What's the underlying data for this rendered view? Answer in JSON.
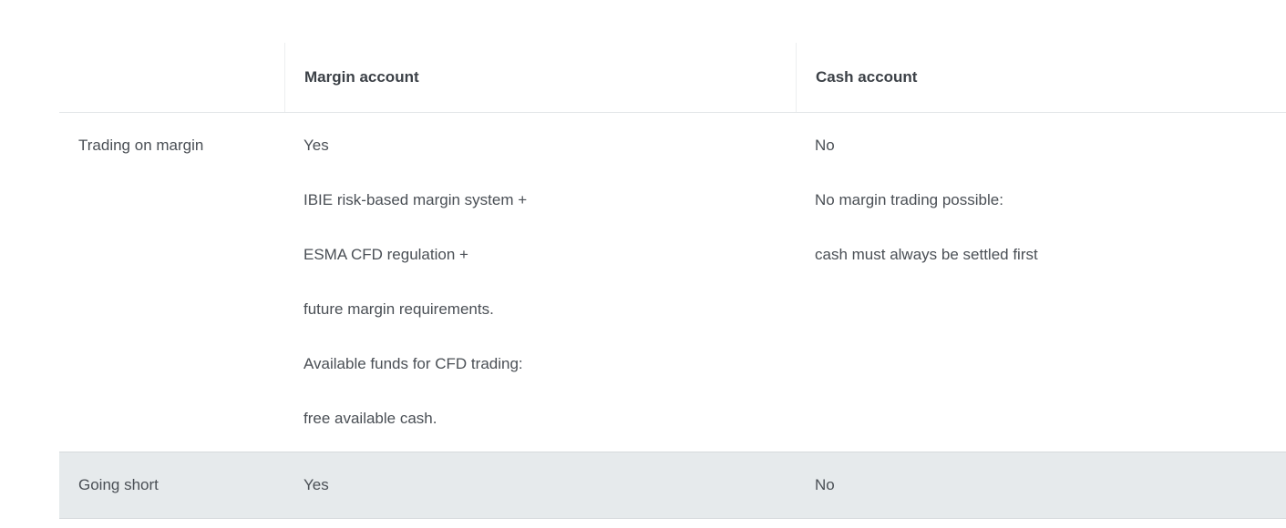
{
  "table": {
    "headers": [
      "",
      "Margin account",
      "Cash account"
    ],
    "rows": [
      {
        "label": "Trading on margin",
        "margin": [
          "Yes",
          "IBIE risk-based margin system +",
          "ESMA CFD regulation +",
          "future margin requirements.",
          "Available funds for CFD trading:",
          "free available cash."
        ],
        "cash": [
          "No",
          "No margin trading possible:",
          "cash must always be settled first"
        ]
      },
      {
        "label": "Going short",
        "margin": [
          "Yes"
        ],
        "cash": [
          "No"
        ]
      }
    ]
  }
}
